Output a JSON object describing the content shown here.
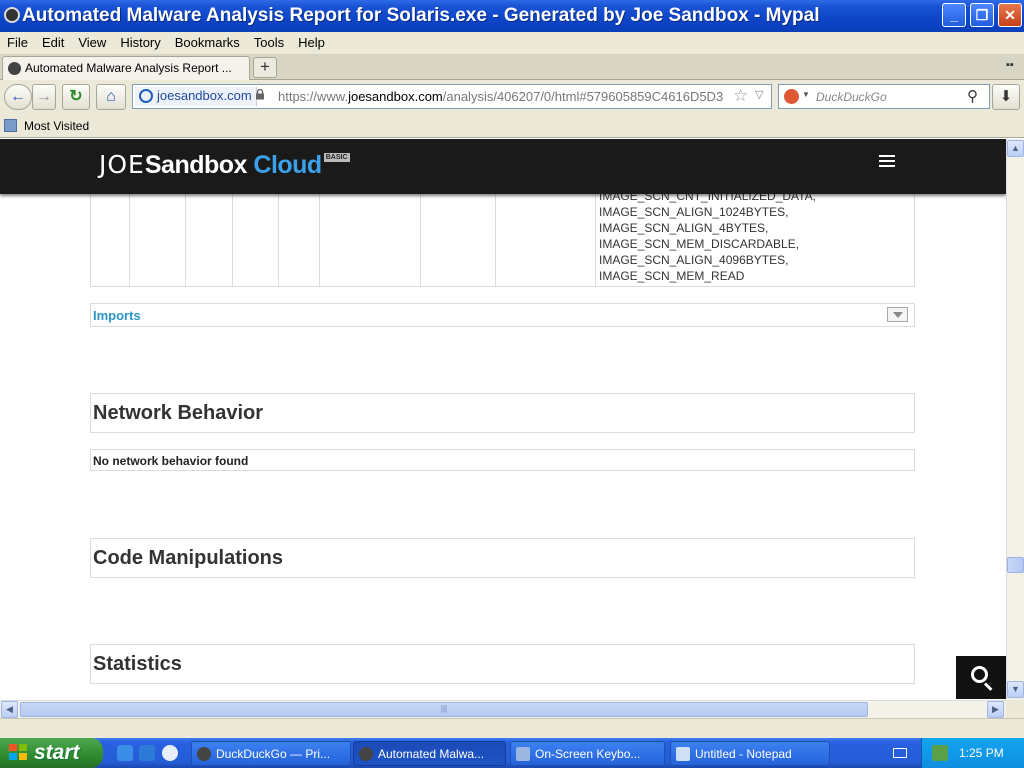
{
  "window": {
    "title": "Automated Malware Analysis Report for Solaris.exe - Generated by Joe Sandbox - Mypal"
  },
  "menu": [
    "File",
    "Edit",
    "View",
    "History",
    "Bookmarks",
    "Tools",
    "Help"
  ],
  "tabs": [
    {
      "label": "Automated Malware Analysis Report ..."
    }
  ],
  "navbar": {
    "identity": "joesandbox.com",
    "url_prefix": "https://www.",
    "url_domain": "joesandbox.com",
    "url_path": "/analysis/406207/0/html#579605859C4616D5D3",
    "search_placeholder": "DuckDuckGo"
  },
  "bookmarks": {
    "most_visited": "Most Visited"
  },
  "site": {
    "logo_joe": "JOE",
    "logo_sandbox": "Sandbox",
    "logo_cloud": "Cloud",
    "logo_badge": "BASIC"
  },
  "sections_table": {
    "characteristics": [
      "IMAGE_SCN_CNT_INITIALIZED_DATA,",
      "IMAGE_SCN_ALIGN_1024BYTES,",
      "IMAGE_SCN_ALIGN_4BYTES,",
      "IMAGE_SCN_MEM_DISCARDABLE,",
      "IMAGE_SCN_ALIGN_4096BYTES,",
      "IMAGE_SCN_MEM_READ"
    ]
  },
  "imports": {
    "label": "Imports"
  },
  "network": {
    "title": "Network Behavior",
    "empty": "No network behavior found"
  },
  "code": {
    "title": "Code Manipulations"
  },
  "statistics": {
    "title": "Statistics"
  },
  "taskbar": {
    "start": "start",
    "tasks": [
      {
        "label": "DuckDuckGo — Pri..."
      },
      {
        "label": "Automated Malwa..."
      },
      {
        "label": "On-Screen Keybo..."
      },
      {
        "label": "Untitled - Notepad"
      }
    ],
    "clock": "1:25 PM"
  },
  "colors": {
    "accent": "#3aa0e8",
    "link": "#2a95c6",
    "header_bg": "#1a1a1a"
  }
}
